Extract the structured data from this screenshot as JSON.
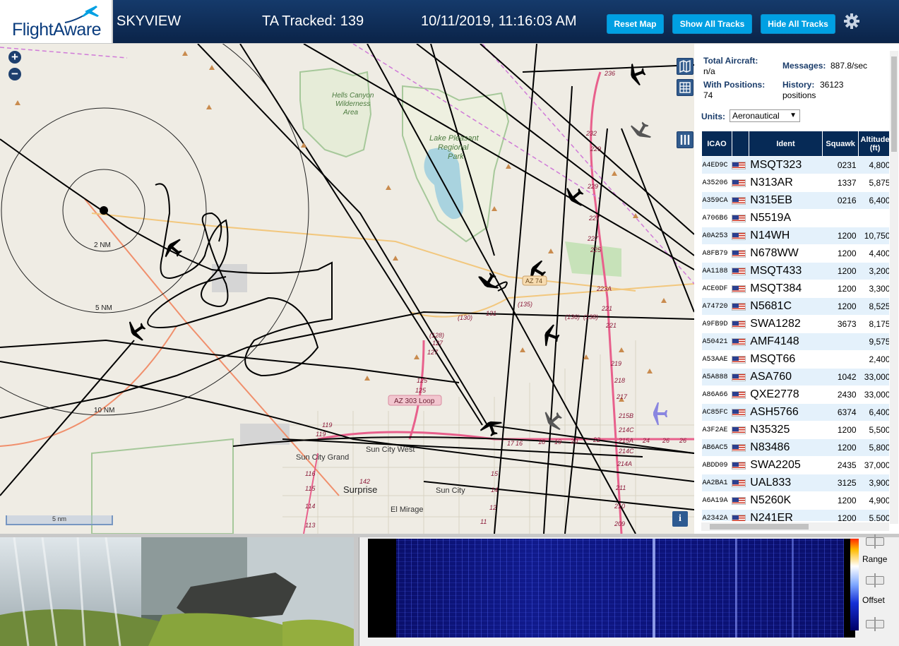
{
  "header": {
    "logo_text": "FlightAware",
    "app_name": "SKYVIEW",
    "tracked": "TA Tracked: 139",
    "datetime": "10/11/2019, 11:16:03 AM",
    "reset_map": "Reset Map",
    "show_all_tracks": "Show All Tracks",
    "hide_all_tracks": "Hide All Tracks",
    "settings_icon": "gear-icon"
  },
  "map": {
    "zoom_in": "+",
    "zoom_out": "−",
    "range_rings": [
      "2 NM",
      "5 NM",
      "10 NM"
    ],
    "scale": "5 nm",
    "info": "i",
    "places": [
      "Hells Canyon Wilderness Area",
      "Lake Pleasant Regional Park",
      "Sun City Grand",
      "Sun City West",
      "Surprise",
      "Sun City",
      "El Mirage"
    ],
    "shields": [
      "AZ 303 Loop",
      "AZ 74"
    ],
    "tools": [
      "map-layers-icon",
      "grid-icon",
      "columns-icon"
    ]
  },
  "sidebar": {
    "total_aircraft_label": "Total Aircraft:",
    "total_aircraft_value": "n/a",
    "messages_label": "Messages:",
    "messages_value": "887.8/sec",
    "with_positions_label": "With Positions:",
    "with_positions_value": "74",
    "history_label": "History:",
    "history_value": "36123",
    "history_unit": "positions",
    "units_label": "Units:",
    "units_value": "Aeronautical",
    "columns": [
      "ICAO",
      "",
      "Ident",
      "Squawk",
      "Altitude (ft)"
    ],
    "rows": [
      {
        "icao": "A4ED9C",
        "ident": "MSQT323",
        "squawk": "0231",
        "alt": "4,800"
      },
      {
        "icao": "A35206",
        "ident": "N313AR",
        "squawk": "1337",
        "alt": "5,875"
      },
      {
        "icao": "A359CA",
        "ident": "N315EB",
        "squawk": "0216",
        "alt": "6,400"
      },
      {
        "icao": "A706B6",
        "ident": "N5519A",
        "squawk": "",
        "alt": ""
      },
      {
        "icao": "A0A253",
        "ident": "N14WH",
        "squawk": "1200",
        "alt": "10,750"
      },
      {
        "icao": "A8FB79",
        "ident": "N678WW",
        "squawk": "1200",
        "alt": "4,400"
      },
      {
        "icao": "AA1188",
        "ident": "MSQT433",
        "squawk": "1200",
        "alt": "3,200"
      },
      {
        "icao": "ACE0DF",
        "ident": "MSQT384",
        "squawk": "1200",
        "alt": "3,300"
      },
      {
        "icao": "A74720",
        "ident": "N5681C",
        "squawk": "1200",
        "alt": "8,525"
      },
      {
        "icao": "A9FB9D",
        "ident": "SWA1282",
        "squawk": "3673",
        "alt": "8,175"
      },
      {
        "icao": "A50421",
        "ident": "AMF4148",
        "squawk": "",
        "alt": "9,575"
      },
      {
        "icao": "A53AAE",
        "ident": "MSQT66",
        "squawk": "",
        "alt": "2,400"
      },
      {
        "icao": "A5A888",
        "ident": "ASA760",
        "squawk": "1042",
        "alt": "33,000"
      },
      {
        "icao": "A86A66",
        "ident": "QXE2778",
        "squawk": "2430",
        "alt": "33,000"
      },
      {
        "icao": "AC85FC",
        "ident": "ASH5766",
        "squawk": "6374",
        "alt": "6,400"
      },
      {
        "icao": "A3F2AE",
        "ident": "N35325",
        "squawk": "1200",
        "alt": "5,500"
      },
      {
        "icao": "AB6AC5",
        "ident": "N83486",
        "squawk": "1200",
        "alt": "5,800"
      },
      {
        "icao": "ABDD09",
        "ident": "SWA2205",
        "squawk": "2435",
        "alt": "37,000"
      },
      {
        "icao": "AA2BA1",
        "ident": "UAL833",
        "squawk": "3125",
        "alt": "3,900"
      },
      {
        "icao": "A6A19A",
        "ident": "N5260K",
        "squawk": "1200",
        "alt": "4,900"
      },
      {
        "icao": "A2342A",
        "ident": "N241ER",
        "squawk": "1200",
        "alt": "5,500"
      }
    ]
  },
  "spectrogram": {
    "range_label": "Range",
    "offset_label": "Offset"
  },
  "colors": {
    "header_bg": "#0f2d57",
    "button_bg": "#00a0e3",
    "table_header_bg": "#062a56",
    "row_tint": "#e4f1fb"
  }
}
